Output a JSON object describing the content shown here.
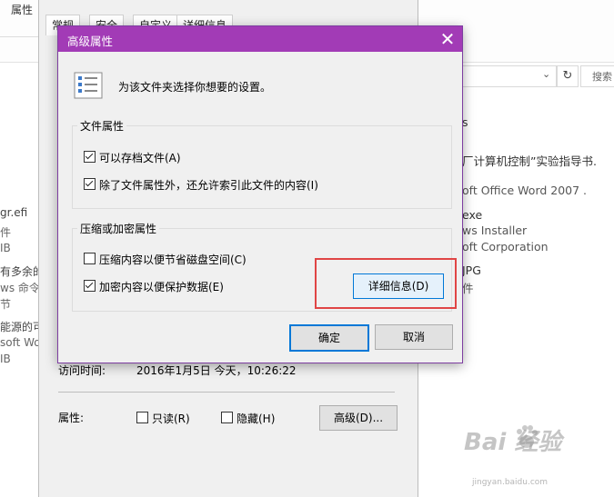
{
  "explorer": {
    "ribbon_tab": "属性",
    "search_placeholder": "搜索",
    "left_fragments": [
      "gr.efi",
      "件",
      "IB",
      "有多余的",
      "ws 命令",
      "节",
      "能源的可",
      "soft Wor",
      "IB"
    ],
    "right_fragments": [
      "s",
      "厂计算机控制”实验指导书.",
      "oft Office Word 2007 .",
      "exe",
      "ws Installer",
      "oft Corporation",
      "JPG",
      "件"
    ]
  },
  "properties": {
    "tabs": [
      "常规",
      "安全",
      "自定义",
      "详细信息"
    ],
    "access_time_label": "访问时间:",
    "access_time_value": "2016年1月5日 今天，10:26:22",
    "attributes_label": "属性:",
    "readonly_label": "只读(R)",
    "readonly_checked": false,
    "hidden_label": "隐藏(H)",
    "hidden_checked": false,
    "advanced_button": "高级(D)..."
  },
  "dialog": {
    "title": "高级属性",
    "close_glyph": "✕",
    "description": "为该文件夹选择你想要的设置。",
    "file_attr_group": "文件属性",
    "archive_label": "可以存档文件(A)",
    "archive_checked": true,
    "index_label": "除了文件属性外，还允许索引此文件的内容(I)",
    "index_checked": true,
    "compress_group": "压缩或加密属性",
    "compress_label": "压缩内容以便节省磁盘空间(C)",
    "compress_checked": false,
    "encrypt_label": "加密内容以便保护数据(E)",
    "encrypt_checked": true,
    "details_button": "详细信息(D)",
    "ok_button": "确定",
    "cancel_button": "取消"
  },
  "watermark": {
    "brand": "Bai 经验",
    "url": "jingyan.baidu.com"
  },
  "colors": {
    "titlebar": "#a23bb6",
    "highlight": "#e04545"
  }
}
